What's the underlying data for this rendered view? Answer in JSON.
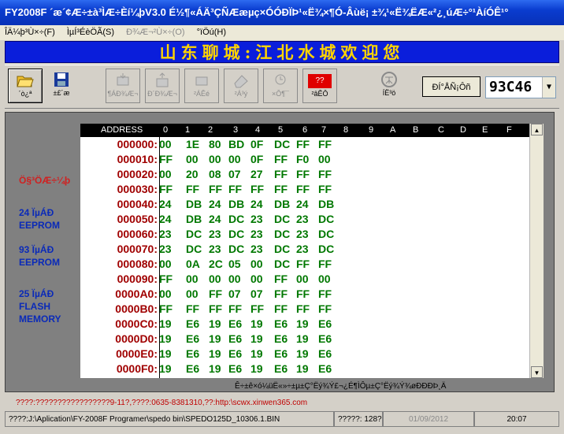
{
  "window": {
    "title": "FY2008F ´æ´¢Æ÷±à³ÌÆ÷Èí¼þV3.0    É½¶«ÁÄ³ÇÑÆæµç×ÓÓÐÏÞ¹«Ë¾×¶Ó-Âùë¡  ±¾¹«Ë¾ËÆ«²¿¸úÆ÷°¹ÀíÓÊ¹°"
  },
  "menu": {
    "items": [
      "ÎÄ¼þ³Ù×÷(F)",
      "ÌµÍ³ÉèÖÃ(S)",
      "Ð¾Æ¬²Ù×÷(O)",
      "°ïÖú(H)"
    ]
  },
  "banner": {
    "text": "山东聊城:江北水城欢迎您"
  },
  "toolbar": {
    "buttons": [
      {
        "label": "´ò¿ª"
      },
      {
        "label": "±£´æ"
      },
      {
        "label": "¶ÁÐ¾Æ¬"
      },
      {
        "label": "Ð´Ð¾Æ¬"
      },
      {
        "label": "²ÁÊé"
      },
      {
        "label": "²Á³ý"
      },
      {
        "label": "×Ô¶¯"
      },
      {
        "label": "²âÊÔ"
      },
      {
        "label": "ÍË³ö"
      }
    ],
    "test_badge": "??",
    "device_button": "ÐÍ°ÅÑ¡Ôñ",
    "device_select": "93C46"
  },
  "sidebar": {
    "label_red": "Ö§³ÖÆ÷¼þ",
    "items": [
      {
        "line1": "24 ÏµÁÐ",
        "line2": "EEPROM"
      },
      {
        "line1": "93 ÏµÁÐ",
        "line2": "EEPROM"
      },
      {
        "line1": "25 ÏµÁÐ",
        "line2": "FLASH",
        "line3": "MEMORY"
      }
    ]
  },
  "hex": {
    "address_header": "ADDRESS",
    "columns": [
      "0",
      "1",
      "2",
      "3",
      "4",
      "5",
      "6",
      "7",
      "8",
      "9",
      "A",
      "B",
      "C",
      "D",
      "E",
      "F"
    ],
    "rows": [
      {
        "addr": "000000:",
        "bytes": [
          "00",
          "1E",
          "80",
          "BD",
          "0F",
          "DC",
          "FF",
          "FF"
        ]
      },
      {
        "addr": "000010:",
        "bytes": [
          "FF",
          "00",
          "00",
          "00",
          "0F",
          "FF",
          "F0",
          "00"
        ]
      },
      {
        "addr": "000020:",
        "bytes": [
          "00",
          "20",
          "08",
          "07",
          "27",
          "FF",
          "FF",
          "FF"
        ]
      },
      {
        "addr": "000030:",
        "bytes": [
          "FF",
          "FF",
          "FF",
          "FF",
          "FF",
          "FF",
          "FF",
          "FF"
        ]
      },
      {
        "addr": "000040:",
        "bytes": [
          "24",
          "DB",
          "24",
          "DB",
          "24",
          "DB",
          "24",
          "DB"
        ]
      },
      {
        "addr": "000050:",
        "bytes": [
          "24",
          "DB",
          "24",
          "DC",
          "23",
          "DC",
          "23",
          "DC"
        ]
      },
      {
        "addr": "000060:",
        "bytes": [
          "23",
          "DC",
          "23",
          "DC",
          "23",
          "DC",
          "23",
          "DC"
        ]
      },
      {
        "addr": "000070:",
        "bytes": [
          "23",
          "DC",
          "23",
          "DC",
          "23",
          "DC",
          "23",
          "DC"
        ]
      },
      {
        "addr": "000080:",
        "bytes": [
          "00",
          "0A",
          "2C",
          "05",
          "00",
          "DC",
          "FF",
          "FF"
        ]
      },
      {
        "addr": "000090:",
        "bytes": [
          "FF",
          "00",
          "00",
          "00",
          "00",
          "FF",
          "00",
          "00"
        ]
      },
      {
        "addr": "0000A0:",
        "bytes": [
          "00",
          "00",
          "FF",
          "07",
          "07",
          "FF",
          "FF",
          "FF"
        ]
      },
      {
        "addr": "0000B0:",
        "bytes": [
          "FF",
          "FF",
          "FF",
          "FF",
          "FF",
          "FF",
          "FF",
          "FF"
        ]
      },
      {
        "addr": "0000C0:",
        "bytes": [
          "19",
          "E6",
          "19",
          "E6",
          "19",
          "E6",
          "19",
          "E6"
        ]
      },
      {
        "addr": "0000D0:",
        "bytes": [
          "19",
          "E6",
          "19",
          "E6",
          "19",
          "E6",
          "19",
          "E6"
        ]
      },
      {
        "addr": "0000E0:",
        "bytes": [
          "19",
          "E6",
          "19",
          "E6",
          "19",
          "E6",
          "19",
          "E6"
        ]
      },
      {
        "addr": "0000F0:",
        "bytes": [
          "19",
          "E6",
          "19",
          "E6",
          "19",
          "E6",
          "19",
          "E6"
        ]
      }
    ],
    "footer": "Ê÷±ê×ó¼üË«»÷±µ±Ç°Ëý¾Ý£¬¿É¶ÌÔµ±Ç°Ëý¾Ý¾øÐÐÐÞ¸Ä"
  },
  "note": "????:?????????????????9-11?,????:0635-8381310,??:http:\\scwx.xinwen365.com",
  "status": {
    "path": "????:J:\\Aplication\\FY-2008F Programer\\spedo bin\\SPEDO125D_10306.1.BIN",
    "size": "?????: 128??",
    "date": "01/09/2012",
    "time": "20:07"
  },
  "colors": {
    "title_bar": "#0a3ccf",
    "banner_bg": "#0a1edb",
    "banner_text": "#ffd400",
    "addr_text": "#a00000",
    "byte_text": "#007800",
    "side_text": "#0a2ab8"
  }
}
